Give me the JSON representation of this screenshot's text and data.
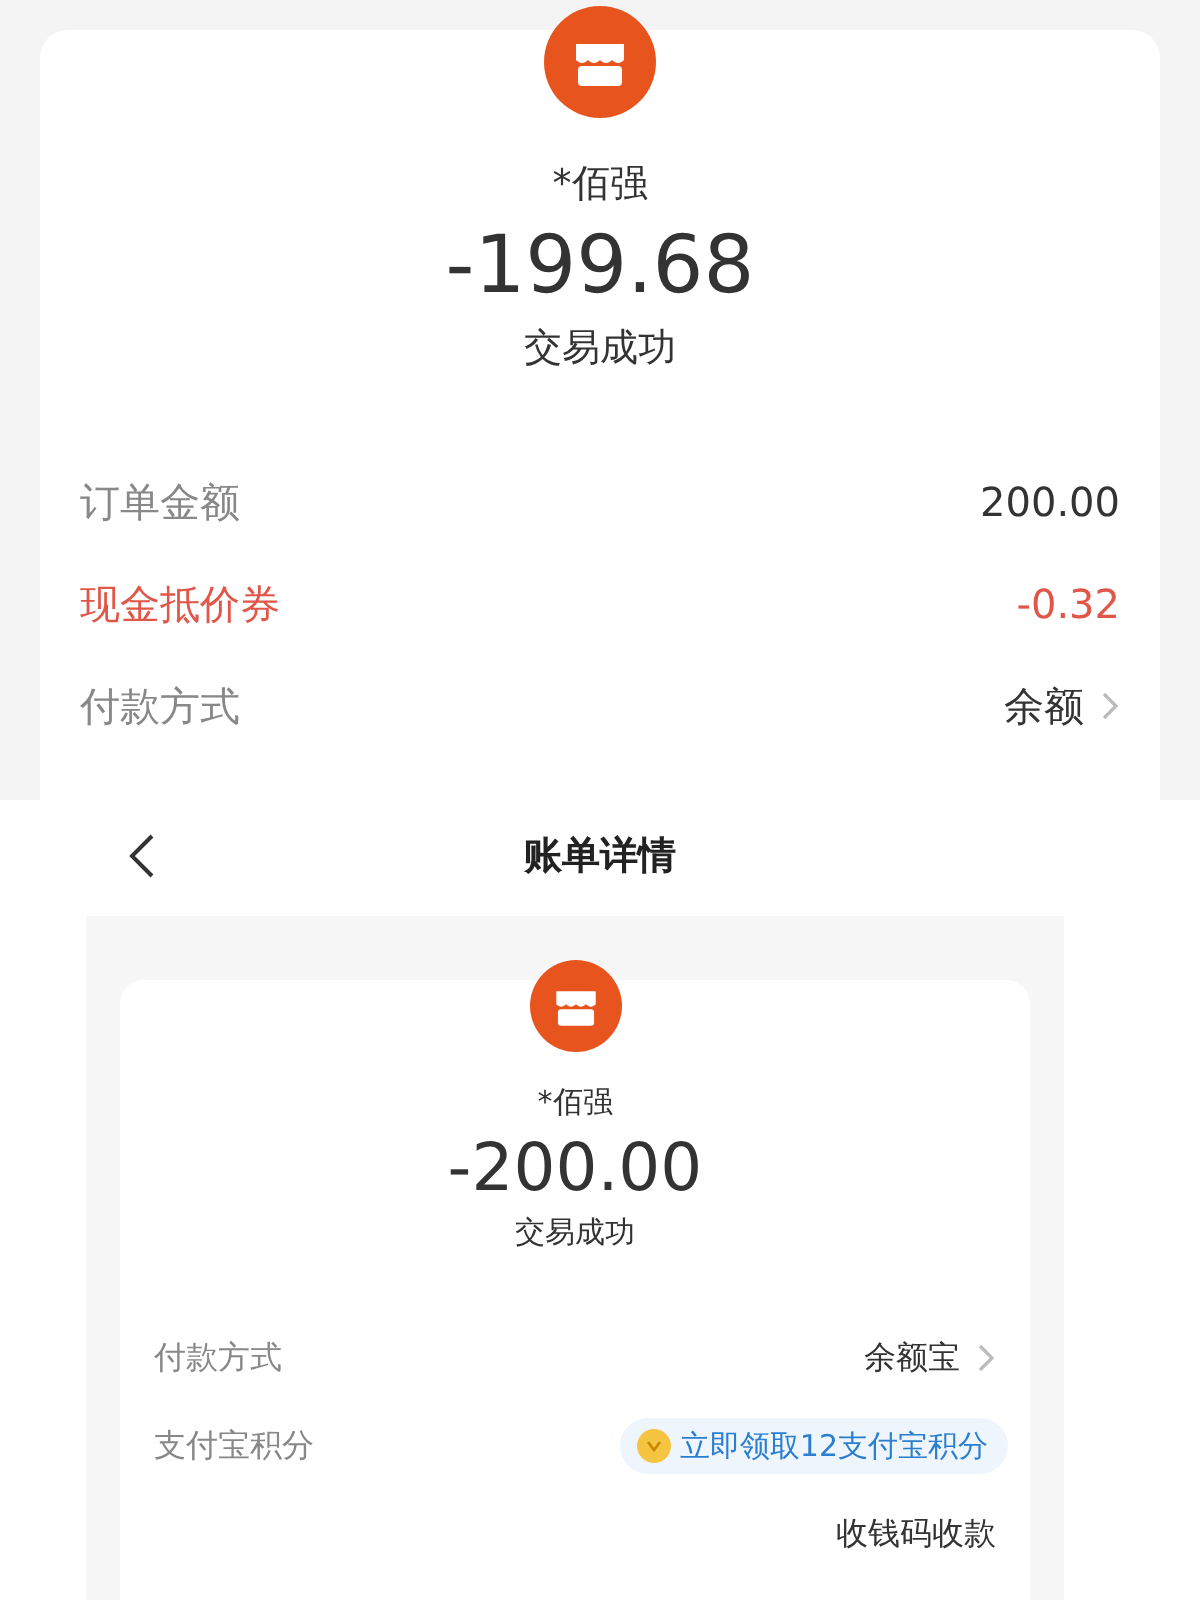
{
  "panels": [
    {
      "kind": "card",
      "merchant": "*佰强",
      "amount": "-199.68",
      "status": "交易成功",
      "rows": [
        {
          "kind": "plain",
          "label": "订单金额",
          "value": "200.00"
        },
        {
          "kind": "discount",
          "label": "现金抵价券",
          "value": "-0.32"
        },
        {
          "kind": "link",
          "label": "付款方式",
          "value": "余额"
        }
      ]
    },
    {
      "kind": "page",
      "title": "账单详情",
      "merchant": "*佰强",
      "amount": "-200.00",
      "status": "交易成功",
      "rows": [
        {
          "kind": "link",
          "label": "付款方式",
          "value": "余额宝"
        },
        {
          "kind": "badge",
          "label": "支付宝积分",
          "value": "立即领取12支付宝积分"
        },
        {
          "kind": "plain",
          "value": "收钱码收款"
        }
      ]
    }
  ]
}
